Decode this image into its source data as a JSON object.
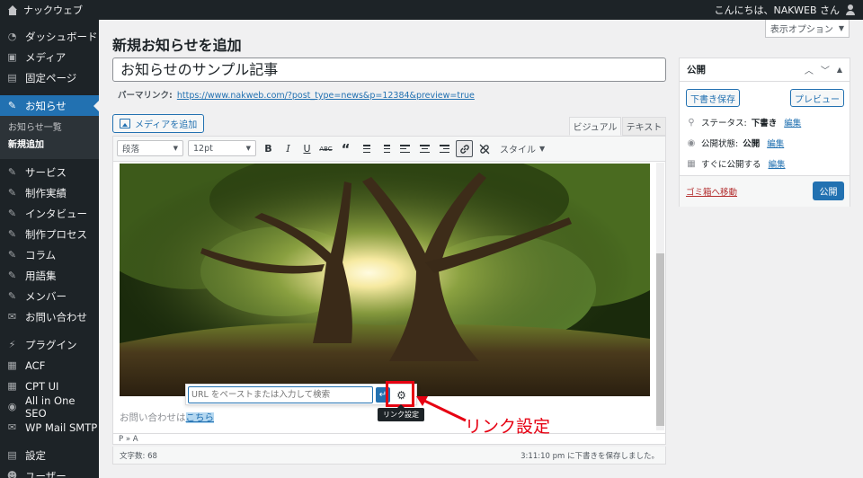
{
  "adminbar": {
    "site_name": "ナックウェブ",
    "greeting": "こんにちは、NAKWEB さん"
  },
  "sidebar": {
    "items": [
      {
        "label": "ダッシュボード",
        "icon": "dashboard-icon"
      },
      {
        "label": "メディア",
        "icon": "media-icon"
      },
      {
        "label": "固定ページ",
        "icon": "page-icon"
      },
      {
        "label": "お知らせ",
        "icon": "pin-icon"
      },
      {
        "label": "サービス",
        "icon": "pin-icon"
      },
      {
        "label": "制作実績",
        "icon": "pin-icon"
      },
      {
        "label": "インタビュー",
        "icon": "pin-icon"
      },
      {
        "label": "制作プロセス",
        "icon": "pin-icon"
      },
      {
        "label": "コラム",
        "icon": "pin-icon"
      },
      {
        "label": "用語集",
        "icon": "pin-icon"
      },
      {
        "label": "メンバー",
        "icon": "pin-icon"
      },
      {
        "label": "お問い合わせ",
        "icon": "mail-icon"
      },
      {
        "label": "プラグイン",
        "icon": "plugin-icon"
      },
      {
        "label": "ACF",
        "icon": "grid-icon"
      },
      {
        "label": "CPT UI",
        "icon": "grid-icon"
      },
      {
        "label": "All in One SEO",
        "icon": "seo-icon"
      },
      {
        "label": "WP Mail SMTP",
        "icon": "mail-smtp-icon"
      },
      {
        "label": "設定",
        "icon": "settings-icon"
      },
      {
        "label": "ユーザー",
        "icon": "user-icon"
      }
    ],
    "submenu": [
      {
        "label": "お知らせ一覧"
      },
      {
        "label": "新規追加"
      }
    ]
  },
  "screen_options": "表示オプション",
  "page_title": "新規お知らせを追加",
  "post_title": "お知らせのサンプル記事",
  "permalink": {
    "label": "パーマリンク:",
    "url": "https://www.nakweb.com/?post_type=news&p=12384&preview=true"
  },
  "add_media": "メディアを追加",
  "tabs": {
    "visual": "ビジュアル",
    "text": "テキスト"
  },
  "toolbar": {
    "format": "段落",
    "font_size": "12pt",
    "style": "スタイル"
  },
  "content": {
    "text": "お問い合わせは",
    "link_text": "こちら"
  },
  "link_popup": {
    "placeholder": "URL をペーストまたは入力して検索",
    "tooltip": "リンク設定"
  },
  "annotation": "リンク設定",
  "path": "P » A",
  "status": {
    "word_count": "文字数: 68",
    "saved": "3:11:10 pm に下書きを保存しました。"
  },
  "publish": {
    "title": "公開",
    "save_draft": "下書き保存",
    "preview": "プレビュー",
    "status_label": "ステータス:",
    "status_value": "下書き",
    "visibility_label": "公開状態:",
    "visibility_value": "公開",
    "schedule_label": "すぐに公開する",
    "edit": "編集",
    "trash": "ゴミ箱へ移動",
    "publish_btn": "公開"
  },
  "colors": {
    "accent": "#2271b1",
    "sidebar_bg": "#1d2327",
    "highlight": "#e60012"
  }
}
